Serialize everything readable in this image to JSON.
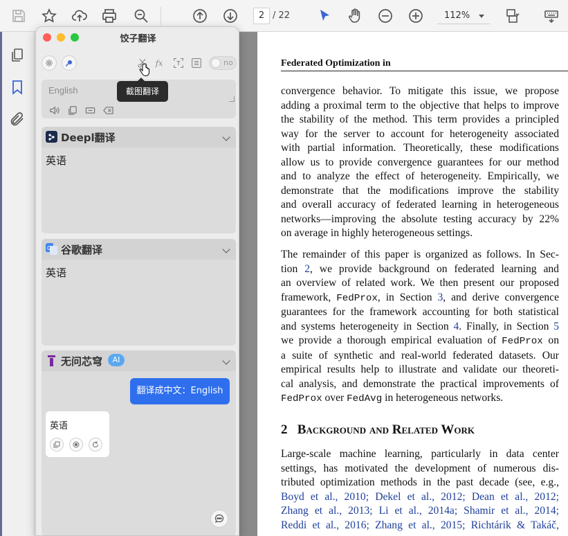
{
  "toolbar": {
    "page_current": "2",
    "page_total": "/ 22",
    "zoom": "112%"
  },
  "panel": {
    "title": "饺子翻译",
    "toggle_label": "no",
    "tooltip": "截图翻译",
    "input_placeholder": "English",
    "cards": [
      {
        "name": "Deepl翻译",
        "text": "英语"
      },
      {
        "name": "谷歌翻译",
        "text": "英语"
      },
      {
        "name": "无问芯穹",
        "badge": "AI",
        "user_msg": "翻译成中文：English",
        "ai_msg": "英语"
      }
    ]
  },
  "pdf": {
    "running_head": "Federated Optimization in",
    "para1": [
      "convergence behavior. To mitigate this issue, we propose",
      "adding a proximal term to the objective that helps to improve",
      "the stability of the method. This term provides a principled",
      "way for the server to account for heterogeneity associated",
      "with partial information. Theoretically, these modifications",
      "allow us to provide convergence guarantees for our method",
      "and to analyze the effect of heterogeneity. Empirically, we",
      "demonstrate that the modifications improve the stability",
      "and overall accuracy of federated learning in heterogeneous",
      "networks—improving the absolute testing accuracy by 22%",
      "on average in highly heterogeneous settings."
    ],
    "para2": {
      "l1": "The remainder of this paper is organized as follows. In Sec-",
      "l2a": "tion ",
      "l2ref": "2",
      "l2b": ", we provide background on federated learning and",
      "l3": "an overview of related work. We then present our proposed",
      "l4a": "framework, ",
      "l4mono": "FedProx",
      "l4b": ", in Section ",
      "l4ref": "3",
      "l4c": ", and derive convergence",
      "l5": "guarantees for the framework accounting for both statistical",
      "l6a": "and systems heterogeneity in Section ",
      "l6ref": "4",
      "l6b": ". Finally, in Section ",
      "l6ref2": "5",
      "l7a": "we provide a thorough empirical evaluation of ",
      "l7mono": "FedProx",
      "l7b": " on",
      "l8": "a suite of synthetic and real-world federated datasets. Our",
      "l9": "empirical results help to illustrate and validate our theoreti-",
      "l10": "cal analysis, and demonstrate the practical improvements of",
      "l11mono": "FedProx",
      "l11b": " over ",
      "l11mono2": "FedAvg",
      "l11c": " in heterogeneous networks."
    },
    "heading_num": "2",
    "heading_text": "Background and Related Work",
    "para3": {
      "l1": "Large-scale machine learning, particularly in data center",
      "l2": "settings, has motivated the development of numerous dis-",
      "l3": "tributed optimization methods in the past decade (see, e.g.,",
      "l4": "Boyd et al., 2010; Dekel et al., 2012; Dean et al., 2012;",
      "l5": "Zhang et al., 2013; Li et al., 2014a; Shamir et al., 2014;",
      "l6": "Reddi et al., 2016; Zhang et al., 2015; Richtárik & Takáč,"
    }
  }
}
